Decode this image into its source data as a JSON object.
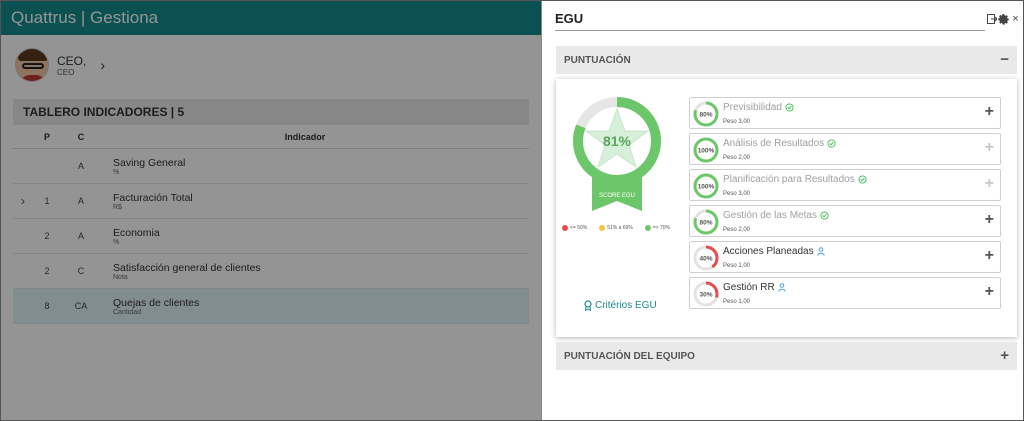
{
  "app": {
    "title": "Quattrus | Gestiona",
    "user": {
      "name": "CEO,",
      "role": "CEO",
      "chevron": "›"
    },
    "board_title": "TABLERO INDICADORES | 5",
    "table": {
      "headers": {
        "p": "P",
        "c": "C",
        "indicador": "Indicador"
      },
      "rows": [
        {
          "expand": "",
          "p": "",
          "c": "A",
          "name": "Saving General",
          "unit": "%"
        },
        {
          "expand": "›",
          "p": "1",
          "c": "A",
          "name": "Facturación Total",
          "unit": "R$"
        },
        {
          "expand": "",
          "p": "2",
          "c": "A",
          "name": "Economia",
          "unit": "%"
        },
        {
          "expand": "",
          "p": "2",
          "c": "C",
          "name": "Satisfacción general de clientes",
          "unit": "Nota"
        },
        {
          "expand": "",
          "p": "8",
          "c": "CA",
          "name": "Quejas de clientes",
          "unit": "Cantidad"
        }
      ]
    }
  },
  "panel": {
    "title": "EGU",
    "icons": [
      "export-icon",
      "gear-icon",
      "close-icon"
    ],
    "close_glyph": "×",
    "sections": {
      "puntuacion": {
        "label": "PUNTUACIÓN",
        "toggle": "−"
      },
      "equipo": {
        "label": "PUNTUACIÓN DEL EQUIPO",
        "toggle": "+"
      }
    },
    "score": {
      "value": 81,
      "value_label": "81%",
      "badge_label": "SCORE EGU",
      "color": "#6cc76a"
    },
    "legend": [
      {
        "label": "<= 50%",
        "color": "#e84c4c"
      },
      {
        "label": "51% a 69%",
        "color": "#f4c542"
      },
      {
        "label": "=> 70%",
        "color": "#6cc76a"
      }
    ],
    "criterios_label": "Critérios EGU",
    "indicators": [
      {
        "name": "Previsibilidad",
        "percent": 80,
        "percent_label": "80%",
        "peso": "Peso 3,00",
        "status_icon": "check-circle-icon",
        "muted": true,
        "plus": "+",
        "plus_color": "#555555",
        "ring_color": "#6cc76a"
      },
      {
        "name": "Análisis de Resultados",
        "percent": 100,
        "percent_label": "100%",
        "peso": "Peso 2,00",
        "status_icon": "check-circle-icon",
        "muted": true,
        "plus": "+",
        "plus_color": "#c8c8c8",
        "ring_color": "#6cc76a"
      },
      {
        "name": "Planificación para Resultados",
        "percent": 100,
        "percent_label": "100%",
        "peso": "Peso 3,00",
        "status_icon": "check-circle-icon",
        "muted": true,
        "plus": "+",
        "plus_color": "#c8c8c8",
        "ring_color": "#6cc76a"
      },
      {
        "name": "Gestión de las Metas",
        "percent": 80,
        "percent_label": "80%",
        "peso": "Peso 2,00",
        "status_icon": "check-circle-icon",
        "muted": true,
        "plus": "+",
        "plus_color": "#555555",
        "ring_color": "#6cc76a"
      },
      {
        "name": "Acciones Planeadas",
        "percent": 40,
        "percent_label": "40%",
        "peso": "Peso 1,00",
        "status_icon": "person-icon",
        "muted": false,
        "plus": "+",
        "plus_color": "#555555",
        "ring_color": "#e84c4c"
      },
      {
        "name": "Gestión RR",
        "percent": 30,
        "percent_label": "30%",
        "peso": "Peso 1,00",
        "status_icon": "person-icon",
        "muted": false,
        "plus": "+",
        "plus_color": "#555555",
        "ring_color": "#e84c4c"
      }
    ]
  }
}
